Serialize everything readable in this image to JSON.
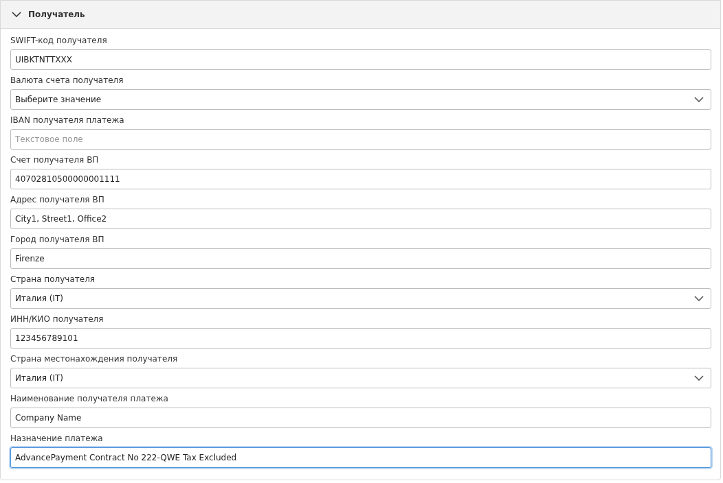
{
  "section": {
    "title": "Получатель",
    "expanded": true
  },
  "fields": [
    {
      "label": "SWIFT-код получателя",
      "kind": "text",
      "value": "UIBKTNTTXXX",
      "focused": false
    },
    {
      "label": "Валюта счета получателя",
      "kind": "select",
      "value": "Выберите значение",
      "focused": false
    },
    {
      "label": "IBAN получателя платежа",
      "kind": "text",
      "placeholder": "Текстовое поле",
      "focused": false
    },
    {
      "label": "Счет получателя ВП",
      "kind": "text",
      "value": "40702810500000001111",
      "focused": false
    },
    {
      "label": "Адрес получателя ВП",
      "kind": "text",
      "value": "City1, Street1, Office2",
      "focused": false
    },
    {
      "label": "Город получателя ВП",
      "kind": "text",
      "value": "Firenze",
      "focused": false
    },
    {
      "label": "Страна получателя",
      "kind": "select",
      "value": "Италия (IT)",
      "focused": false
    },
    {
      "label": "ИНН/КИО получателя",
      "kind": "text",
      "value": "123456789101",
      "focused": false
    },
    {
      "label": "Страна местонахождения получателя",
      "kind": "select",
      "value": "Италия (IT)",
      "focused": false
    },
    {
      "label": "Наименование получателя платежа",
      "kind": "text",
      "value": "Company Name",
      "focused": false
    },
    {
      "label": "Назначение платежа",
      "kind": "text",
      "value": "AdvancePayment Contract No 222-QWE Tax Excluded",
      "focused": true
    }
  ]
}
